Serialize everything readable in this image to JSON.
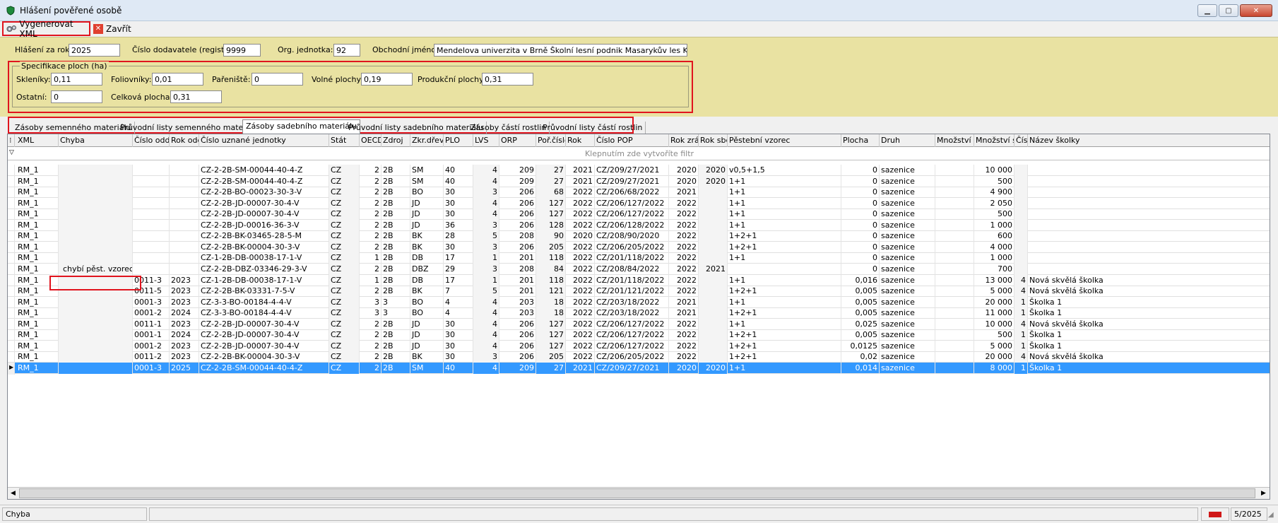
{
  "window": {
    "title": "Hlášení pověřené osobě"
  },
  "toolbar": {
    "generate_label": "Vygenerovat XML",
    "close_label": "Zavřít"
  },
  "form": {
    "year_label": "Hlášení za rok:",
    "year_value": "2025",
    "supplier_label": "Číslo dodavatele (registr):",
    "supplier_value": "9999",
    "org_label": "Org. jednotka:",
    "org_value": "92",
    "name_label": "Obchodní jméno:",
    "name_value": "Mendelova univerzita v Brně Školní lesní podnik Masarykův les Křtiny"
  },
  "areas": {
    "title": "Specifikace ploch (ha)",
    "skleniky_label": "Skleníky:",
    "skleniky_value": "0,11",
    "foliovniky_label": "Foliovníky:",
    "foliovniky_value": "0,01",
    "parenist_label": "Pařeniště:",
    "parenist_value": "0",
    "volne_label": "Volné plochy:",
    "volne_value": "0,19",
    "produkcni_label": "Produkční plochy:",
    "produkcni_value": "0,31",
    "ostatni_label": "Ostatní:",
    "ostatni_value": "0",
    "celkova_label": "Celková plocha:",
    "celkova_value": "0,31"
  },
  "tabs": [
    "Zásoby semenného materiálu",
    "Průvodní listy semenného materiálu",
    "Zásoby sadebního materiálu",
    "Průvodní listy sadebního materiálu",
    "Zásoby částí rostlin",
    "Průvodní listy částí rostlin"
  ],
  "grid": {
    "columns": [
      "XML",
      "Chyba",
      "Číslo oddílu",
      "Rok oddíl",
      "Číslo uznané jednotky",
      "Stát",
      "OECD",
      "Zdroj",
      "Zkr.dřev.",
      "PLO",
      "LVS",
      "ORP",
      "Poř.číslo",
      "Rok",
      "Číslo POP",
      "Rok zrání",
      "Rok sběru",
      "Pěstební vzorec",
      "Plocha",
      "Druh",
      "Množství ser",
      "Množství sac",
      "Čís.",
      "Název školky"
    ],
    "filter_text": "Klepnutím zde vytvoříte filtr",
    "rows": [
      [
        "RM_1",
        "",
        "",
        "",
        "CZ-2-2B-SM-00044-40-4-Z",
        "CZ",
        "2",
        "2B",
        "SM",
        "40",
        "4",
        "209",
        "27",
        "2021",
        "CZ/209/27/2021",
        "2020",
        "2020",
        "v0,5+1,5",
        "0",
        "sazenice",
        "",
        "10 000",
        "",
        ""
      ],
      [
        "RM_1",
        "",
        "",
        "",
        "CZ-2-2B-SM-00044-40-4-Z",
        "CZ",
        "2",
        "2B",
        "SM",
        "40",
        "4",
        "209",
        "27",
        "2021",
        "CZ/209/27/2021",
        "2020",
        "2020",
        "1+1",
        "0",
        "sazenice",
        "",
        "500",
        "",
        ""
      ],
      [
        "RM_1",
        "",
        "",
        "",
        "CZ-2-2B-BO-00023-30-3-V",
        "CZ",
        "2",
        "2B",
        "BO",
        "30",
        "3",
        "206",
        "68",
        "2022",
        "CZ/206/68/2022",
        "2021",
        "",
        "1+1",
        "0",
        "sazenice",
        "",
        "4 900",
        "",
        ""
      ],
      [
        "RM_1",
        "",
        "",
        "",
        "CZ-2-2B-JD-00007-30-4-V",
        "CZ",
        "2",
        "2B",
        "JD",
        "30",
        "4",
        "206",
        "127",
        "2022",
        "CZ/206/127/2022",
        "2022",
        "",
        "1+1",
        "0",
        "sazenice",
        "",
        "2 050",
        "",
        ""
      ],
      [
        "RM_1",
        "",
        "",
        "",
        "CZ-2-2B-JD-00007-30-4-V",
        "CZ",
        "2",
        "2B",
        "JD",
        "30",
        "4",
        "206",
        "127",
        "2022",
        "CZ/206/127/2022",
        "2022",
        "",
        "1+1",
        "0",
        "sazenice",
        "",
        "500",
        "",
        ""
      ],
      [
        "RM_1",
        "",
        "",
        "",
        "CZ-2-2B-JD-00016-36-3-V",
        "CZ",
        "2",
        "2B",
        "JD",
        "36",
        "3",
        "206",
        "128",
        "2022",
        "CZ/206/128/2022",
        "2022",
        "",
        "1+1",
        "0",
        "sazenice",
        "",
        "1 000",
        "",
        ""
      ],
      [
        "RM_1",
        "",
        "",
        "",
        "CZ-2-2B-BK-03465-28-5-M",
        "CZ",
        "2",
        "2B",
        "BK",
        "28",
        "5",
        "208",
        "90",
        "2020",
        "CZ/208/90/2020",
        "2022",
        "",
        "1+2+1",
        "0",
        "sazenice",
        "",
        "600",
        "",
        ""
      ],
      [
        "RM_1",
        "",
        "",
        "",
        "CZ-2-2B-BK-00004-30-3-V",
        "CZ",
        "2",
        "2B",
        "BK",
        "30",
        "3",
        "206",
        "205",
        "2022",
        "CZ/206/205/2022",
        "2022",
        "",
        "1+2+1",
        "0",
        "sazenice",
        "",
        "4 000",
        "",
        ""
      ],
      [
        "RM_1",
        "",
        "",
        "",
        "CZ-1-2B-DB-00038-17-1-V",
        "CZ",
        "1",
        "2B",
        "DB",
        "17",
        "1",
        "201",
        "118",
        "2022",
        "CZ/201/118/2022",
        "2022",
        "",
        "1+1",
        "0",
        "sazenice",
        "",
        "1 000",
        "",
        ""
      ],
      [
        "RM_1",
        "chybí pěst. vzorec",
        "",
        "",
        "CZ-2-2B-DBZ-03346-29-3-V",
        "CZ",
        "2",
        "2B",
        "DBZ",
        "29",
        "3",
        "208",
        "84",
        "2022",
        "CZ/208/84/2022",
        "2022",
        "2021",
        "",
        "0",
        "sazenice",
        "",
        "700",
        "",
        ""
      ],
      [
        "RM_1",
        "",
        "0011-3",
        "2023",
        "CZ-1-2B-DB-00038-17-1-V",
        "CZ",
        "1",
        "2B",
        "DB",
        "17",
        "1",
        "201",
        "118",
        "2022",
        "CZ/201/118/2022",
        "2022",
        "",
        "1+1",
        "0,016",
        "sazenice",
        "",
        "13 000",
        "4",
        "Nová skvělá školka"
      ],
      [
        "RM_1",
        "",
        "0011-5",
        "2023",
        "CZ-2-2B-BK-03331-7-5-V",
        "CZ",
        "2",
        "2B",
        "BK",
        "7",
        "5",
        "201",
        "121",
        "2022",
        "CZ/201/121/2022",
        "2022",
        "",
        "1+2+1",
        "0,005",
        "sazenice",
        "",
        "5 000",
        "4",
        "Nová skvělá školka"
      ],
      [
        "RM_1",
        "",
        "0001-3",
        "2023",
        "CZ-3-3-BO-00184-4-4-V",
        "CZ",
        "3",
        "3",
        "BO",
        "4",
        "4",
        "203",
        "18",
        "2022",
        "CZ/203/18/2022",
        "2021",
        "",
        "1+1",
        "0,005",
        "sazenice",
        "",
        "20 000",
        "1",
        "Školka 1"
      ],
      [
        "RM_1",
        "",
        "0001-2",
        "2024",
        "CZ-3-3-BO-00184-4-4-V",
        "CZ",
        "3",
        "3",
        "BO",
        "4",
        "4",
        "203",
        "18",
        "2022",
        "CZ/203/18/2022",
        "2021",
        "",
        "1+2+1",
        "0,005",
        "sazenice",
        "",
        "11 000",
        "1",
        "Školka 1"
      ],
      [
        "RM_1",
        "",
        "0011-1",
        "2023",
        "CZ-2-2B-JD-00007-30-4-V",
        "CZ",
        "2",
        "2B",
        "JD",
        "30",
        "4",
        "206",
        "127",
        "2022",
        "CZ/206/127/2022",
        "2022",
        "",
        "1+1",
        "0,025",
        "sazenice",
        "",
        "10 000",
        "4",
        "Nová skvělá školka"
      ],
      [
        "RM_1",
        "",
        "0001-1",
        "2024",
        "CZ-2-2B-JD-00007-30-4-V",
        "CZ",
        "2",
        "2B",
        "JD",
        "30",
        "4",
        "206",
        "127",
        "2022",
        "CZ/206/127/2022",
        "2022",
        "",
        "1+2+1",
        "0,005",
        "sazenice",
        "",
        "500",
        "1",
        "Školka 1"
      ],
      [
        "RM_1",
        "",
        "0001-2",
        "2023",
        "CZ-2-2B-JD-00007-30-4-V",
        "CZ",
        "2",
        "2B",
        "JD",
        "30",
        "4",
        "206",
        "127",
        "2022",
        "CZ/206/127/2022",
        "2022",
        "",
        "1+2+1",
        "0,0125",
        "sazenice",
        "",
        "5 000",
        "1",
        "Školka 1"
      ],
      [
        "RM_1",
        "",
        "0011-2",
        "2023",
        "CZ-2-2B-BK-00004-30-3-V",
        "CZ",
        "2",
        "2B",
        "BK",
        "30",
        "3",
        "206",
        "205",
        "2022",
        "CZ/206/205/2022",
        "2022",
        "",
        "1+2+1",
        "0,02",
        "sazenice",
        "",
        "20 000",
        "4",
        "Nová skvělá školka"
      ],
      [
        "RM_1",
        "",
        "0001-3",
        "2025",
        "CZ-2-2B-SM-00044-40-4-Z",
        "CZ",
        "2",
        "2B",
        "SM",
        "40",
        "4",
        "209",
        "27",
        "2021",
        "CZ/209/27/2021",
        "2020",
        "2020",
        "1+1",
        "0,014",
        "sazenice",
        "",
        "8 000",
        "1",
        "Školka 1"
      ]
    ]
  },
  "status": {
    "left": "Chyba",
    "right": "5/2025"
  },
  "colors": {
    "form_bg": "#e9e2a2",
    "highlight": "#e0141e",
    "selection": "#3399ff"
  }
}
